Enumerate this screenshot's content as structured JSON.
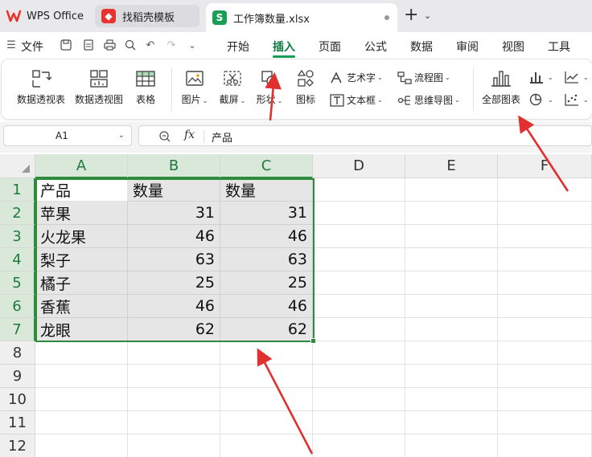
{
  "tabs": {
    "wps": "WPS Office",
    "template": "找稻壳模板",
    "workbook": "工作簿数量.xlsx"
  },
  "menu": {
    "file": "文件",
    "items": [
      "开始",
      "插入",
      "页面",
      "公式",
      "数据",
      "审阅",
      "视图",
      "工具"
    ],
    "active": "插入"
  },
  "ribbon": {
    "pivot_table": "数据透视表",
    "pivot_chart": "数据透视图",
    "table": "表格",
    "picture": "图片",
    "screenshot": "截屏",
    "shape": "形状",
    "icon": "图标",
    "wordart": "艺术字",
    "textbox": "文本框",
    "flowchart": "流程图",
    "mindmap": "思维导图",
    "all_charts": "全部图表"
  },
  "formula_bar": {
    "name_box": "A1",
    "fx": "fx",
    "content": "产品"
  },
  "sheet": {
    "columns": [
      "A",
      "B",
      "C",
      "D",
      "E",
      "F"
    ],
    "rows": [
      "1",
      "2",
      "3",
      "4",
      "5",
      "6",
      "7",
      "8",
      "9",
      "10",
      "11",
      "12"
    ],
    "cells": [
      [
        "产品",
        "数量",
        "数量"
      ],
      [
        "苹果",
        "31",
        "31"
      ],
      [
        "火龙果",
        "46",
        "46"
      ],
      [
        "梨子",
        "63",
        "63"
      ],
      [
        "橘子",
        "25",
        "25"
      ],
      [
        "香蕉",
        "46",
        "46"
      ],
      [
        "龙眼",
        "62",
        "62"
      ]
    ]
  },
  "colors": {
    "accent": "#2e8b3e",
    "annotation": "#e03030",
    "wps_red": "#e8322d",
    "sheet_green": "#1a9d55"
  }
}
